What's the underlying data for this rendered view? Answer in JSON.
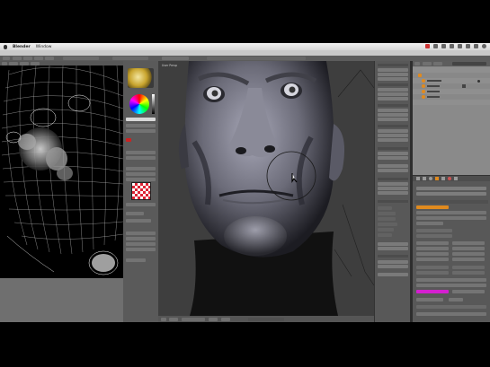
{
  "menubar": {
    "app_name": "Blender",
    "window_menu": "Window"
  },
  "viewport": {
    "view_label": "User Persp"
  },
  "colors": {
    "background": "#000000",
    "panel": "#585858",
    "viewport": "#3e3e3e",
    "accent_orange": "#e08a1e",
    "accent_magenta": "#d41fd0"
  },
  "icons": [
    "apple-icon",
    "brush-icon",
    "color-wheel-icon",
    "texture-checker-icon",
    "eye-icon",
    "camera-icon",
    "render-icon"
  ]
}
